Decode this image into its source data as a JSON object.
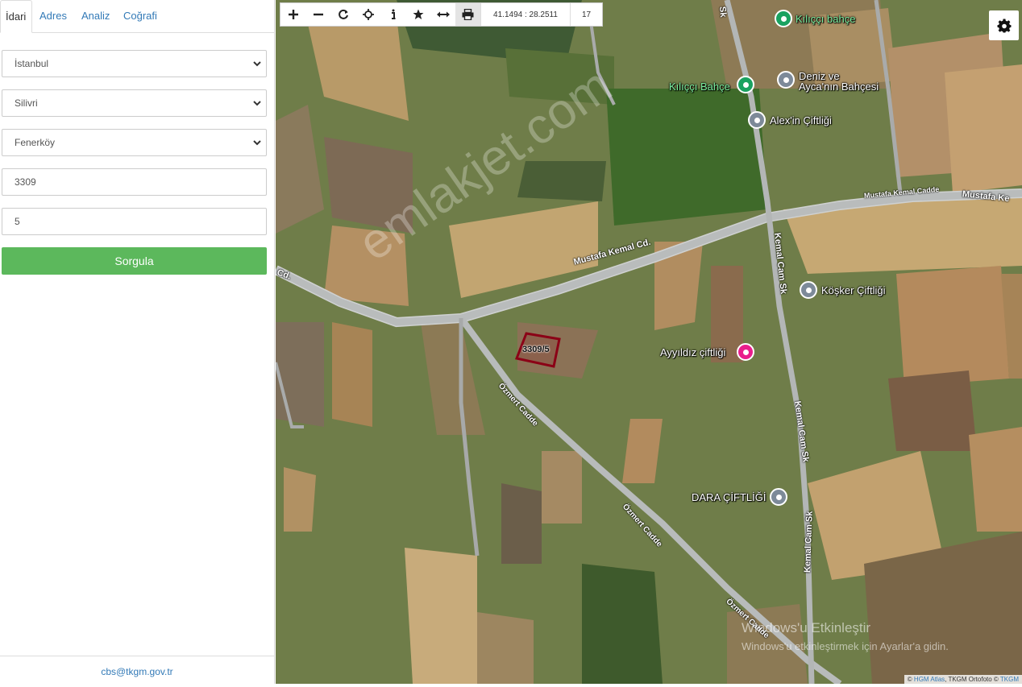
{
  "tabs": [
    {
      "label": "İdari",
      "active": true
    },
    {
      "label": "Adres",
      "active": false
    },
    {
      "label": "Analiz",
      "active": false
    },
    {
      "label": "Coğrafi",
      "active": false
    }
  ],
  "form": {
    "il": "İstanbul",
    "ilce": "Silivri",
    "mahalle": "Fenerköy",
    "ada": "3309",
    "parsel": "5",
    "submit_label": "Sorgula"
  },
  "footer": {
    "email": "cbs@tkgm.gov.tr"
  },
  "toolbar": {
    "icons": [
      "zoom-in-icon",
      "zoom-out-icon",
      "refresh-icon",
      "locate-icon",
      "info-icon",
      "star-icon",
      "measure-icon",
      "print-icon"
    ],
    "coordinates": "41.1494 : 28.2511",
    "zoom_level": "17"
  },
  "map": {
    "parcel_label": "3309/5",
    "watermark": "emlakjet.com",
    "pois": {
      "kilicci_bahce_top": "Kılıççı bahçe",
      "kilicci_bahce": "Kılıççı Bahçe",
      "deniz_ayca_1": "Deniz ve",
      "deniz_ayca_2": "Ayca'nın Bahçesi",
      "alex": "Alex'in Çiftliği",
      "kosker": "Köşker Çiftliği",
      "ayyildiz": "Ayyıldız çiftliği",
      "dara": "DARA ÇİFTLİĞİ"
    },
    "roads": {
      "mustafa_kemal_1": "Mustafa Kemal Cd.",
      "mustafa_kemal_2": "Mustafa Kemal Cadde",
      "mustafa_kemal_3": "Mustafa Ke",
      "kemal_cam_1": "Kemal Cam Sk",
      "kemal_cam_2": "Kemal Cam Sk",
      "kemal_cam_3": "Kemal Cam Sk",
      "ozmert_1": "Özmert Cadde",
      "ozmert_2": "Özmert Cadde",
      "ozmert_3": "Özmert Cadde",
      "cd_left": "Cd.",
      "sk_top": "Sk"
    },
    "windows_notice": {
      "line1": "Windows'u Etkinleştir",
      "line2": "Windows'u etkinleştirmek için Ayarlar'a gidin."
    },
    "attribution": {
      "prefix": "© ",
      "link1": "HGM Atlas",
      "middle": ", TKGM Ortofoto © ",
      "link2": "TKGM"
    }
  },
  "colors": {
    "primary_link": "#337ab7",
    "submit_green": "#5cb85c",
    "parcel_outline": "#8b0016",
    "poi_green": "#1aa260",
    "poi_pink": "#e91e8c",
    "poi_grey": "#7d8a99"
  }
}
